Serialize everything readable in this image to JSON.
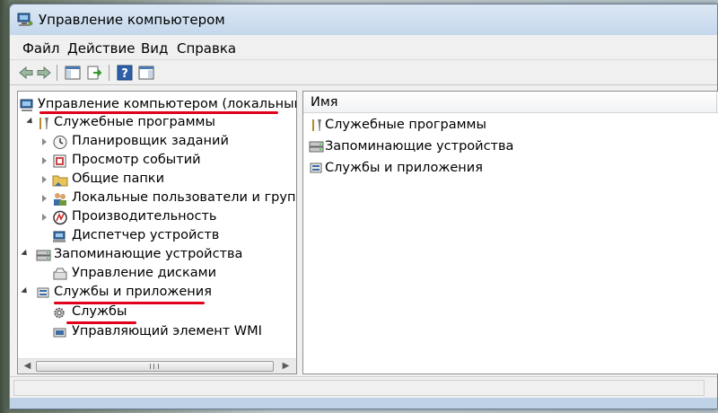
{
  "window": {
    "title": "Управление компьютером"
  },
  "menu": {
    "items": [
      "Файл",
      "Действие",
      "Вид",
      "Справка"
    ]
  },
  "toolbar": {
    "buttons": [
      "back-arrow-icon",
      "forward-arrow-icon",
      "show-hide-console-tree-icon",
      "export-list-icon",
      "help-icon",
      "show-hide-action-pane-icon"
    ]
  },
  "tree": {
    "root": "Управление компьютером (локальным)",
    "system_tools": "Служебные программы",
    "task_scheduler": "Планировщик заданий",
    "event_viewer": "Просмотр событий",
    "shared_folders": "Общие папки",
    "local_users": "Локальные пользователи и группы",
    "performance": "Производительность",
    "device_manager": "Диспетчер устройств",
    "storage": "Запоминающие устройства",
    "disk_management": "Управление дисками",
    "services_apps": "Службы и приложения",
    "services": "Службы",
    "wmi": "Управляющий элемент WMI"
  },
  "list": {
    "column_name": "Имя",
    "rows": [
      "Служебные программы",
      "Запоминающие устройства",
      "Службы и приложения"
    ]
  },
  "annotations": {
    "highlight_color": "#e0001a"
  }
}
